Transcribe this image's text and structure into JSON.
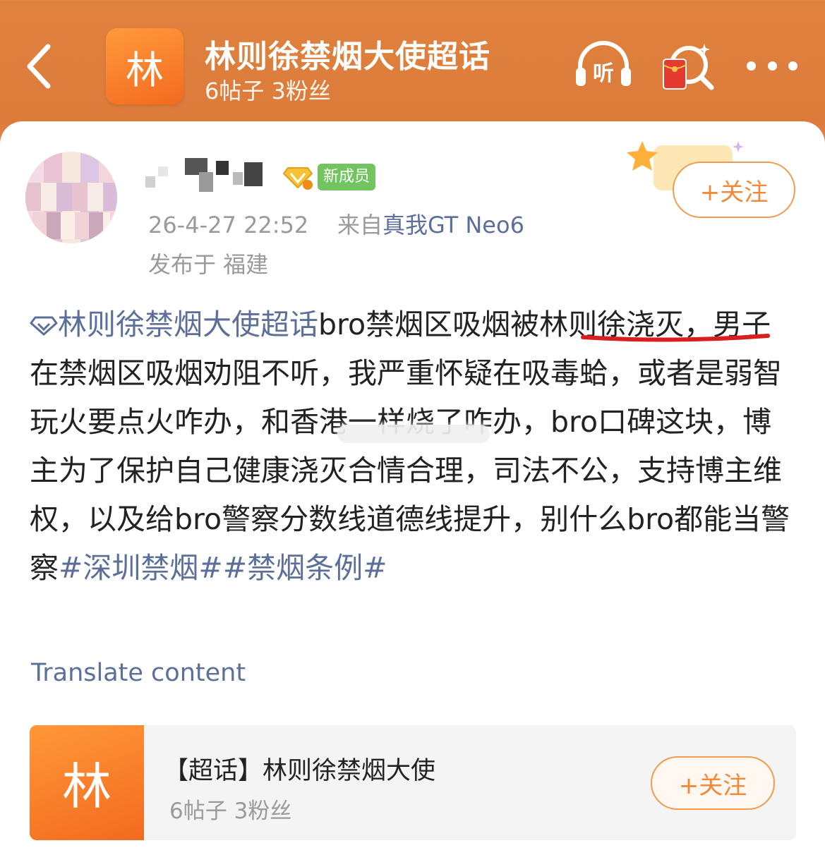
{
  "header": {
    "back_icon": "chevron-left-icon",
    "logo_char": "林",
    "title": "林则徐禁烟大使超话",
    "subtitle": "6帖子 3粉丝",
    "listen_icon": "headphones-icon",
    "listen_label": "听",
    "redpack_icon": "red-envelope-search-icon",
    "more_icon": "more-dots-icon"
  },
  "post": {
    "username_icon": "blurred-username",
    "vip_icon": "diamond-badge-icon",
    "badge": "新成员",
    "follow_label": "+关注",
    "time": "26-4-27 22:52",
    "from_label": "来自",
    "device": "真我GT Neo6",
    "location": "发布于 福建",
    "topic_link": "林则徐禁烟大使超话",
    "text": "bro禁烟区吸烟被林则徐浇灭，男子在禁烟区吸烟劝阻不听，我严重怀疑在吸毒蛤，或者是弱智玩火要点火咋办，和香港一样烧了咋办，bro口碑这块，博主为了保护自己健康浇灭合情合理，司法不公，支持博主维权，以及给bro警察分数线道德线提升，别什么bro都能当警察",
    "hashtag1": "#深圳禁烟#",
    "hashtag2": "#禁烟条例#",
    "translate": "Translate content"
  },
  "topic_card": {
    "logo_char": "林",
    "title": "【超话】林则徐禁烟大使",
    "subtitle": "6帖子 3粉丝",
    "follow_label": "+关注"
  },
  "colors": {
    "header_orange": "#e0833e",
    "link_blue": "#5c6f9a",
    "follow_orange": "#f08a3a",
    "badge_green": "#71c45f",
    "underline_red": "#d81e1e"
  }
}
